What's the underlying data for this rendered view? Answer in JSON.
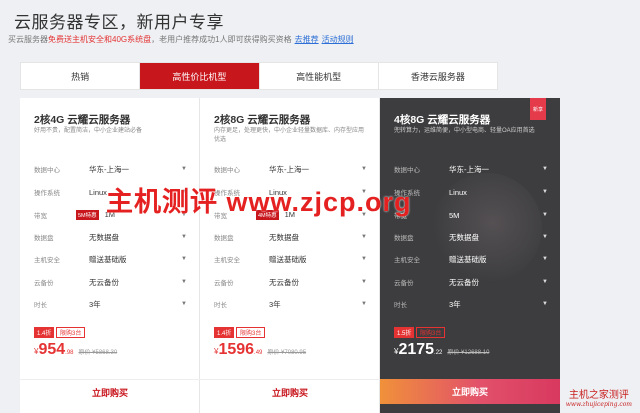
{
  "header": {
    "title": "云服务器专区，新用户专享",
    "sub_prefix": "买云服务器",
    "sub_highlight": "免费送主机安全和40G系统盘",
    "sub_middle": "，老用户推荐成功1人即可获得购买资格",
    "link_recommend": "去推荐",
    "link_rules": "活动规则"
  },
  "tabs": [
    {
      "label": "热销",
      "active": false
    },
    {
      "label": "高性价比机型",
      "active": true
    },
    {
      "label": "高性能机型",
      "active": false
    },
    {
      "label": "香港云服务器",
      "active": false
    }
  ],
  "labels": {
    "region": "数据中心",
    "os": "操作系统",
    "bandwidth": "带宽",
    "data_disk": "数据盘",
    "host_security": "主机安全",
    "backup": "云备份",
    "duration": "时长",
    "buy": "立即购买"
  },
  "cards": [
    {
      "title": "2核4G 云耀云服务器",
      "desc": "好用不贵，配置简洁，中小企业建站必备",
      "region": "华东-上海一",
      "os": "Linux",
      "bw_badge": "5M特惠",
      "bandwidth": "1M",
      "data_disk": "无数据盘",
      "host_security": "赠送基础版",
      "backup": "无云备份",
      "duration": "3年",
      "discount": "1.4折",
      "limit": "限购3台",
      "currency": "¥",
      "price_int": "954",
      "price_dec": ".98",
      "orig": "原价 ¥5868.30"
    },
    {
      "title": "2核8G 云耀云服务器",
      "desc": "内存更足，处理更快，中小企业轻量数据库、内存型应用优选",
      "region": "华东-上海一",
      "os": "Linux",
      "bw_badge": "4M特惠",
      "bandwidth": "1M",
      "data_disk": "无数据盘",
      "host_security": "赠送基础版",
      "backup": "无云备份",
      "duration": "3年",
      "discount": "1.4折",
      "limit": "限购3台",
      "currency": "¥",
      "price_int": "1596",
      "price_dec": ".49",
      "orig": "原价 ¥7080.95"
    },
    {
      "title": "4核8G 云耀云服务器",
      "desc": "兜转算力，运维简便，中小型电商、轻量OA应用首选",
      "ribbon": "新享",
      "region": "华东-上海一",
      "os": "Linux",
      "bw_badge": "",
      "bandwidth": "5M",
      "data_disk": "无数据盘",
      "host_security": "赠送基础版",
      "backup": "无云备份",
      "duration": "3年",
      "discount": "1.5折",
      "limit": "限购3台",
      "currency": "¥",
      "price_int": "2175",
      "price_dec": ".22",
      "orig": "原价 ¥12688.10"
    }
  ],
  "watermark": {
    "main": "主机测评 www.zjcp.org",
    "corner_big": "主机之家测评",
    "corner_small": "www.zhujiceping.com"
  }
}
